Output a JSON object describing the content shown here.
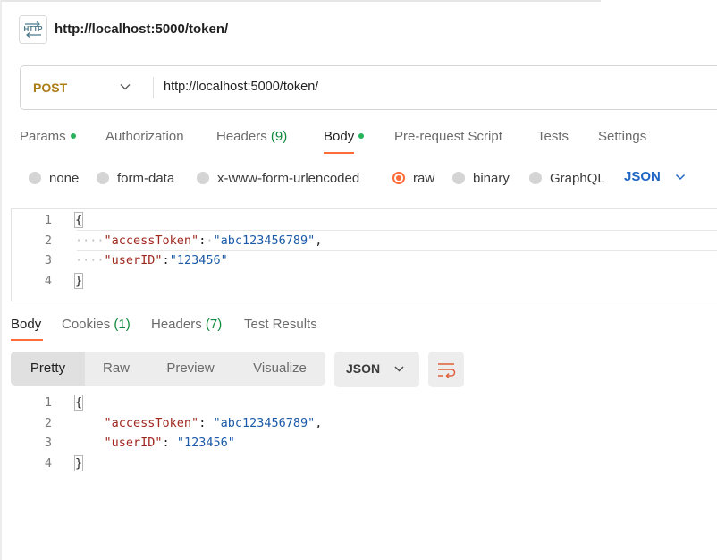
{
  "header": {
    "title": "http://localhost:5000/token/",
    "icon": "http-icon"
  },
  "request": {
    "method": "POST",
    "url": "http://localhost:5000/token/",
    "tabs": [
      {
        "label": "Params"
      },
      {
        "label": "Authorization"
      },
      {
        "label": "Headers",
        "count": "(9)"
      },
      {
        "label": "Body"
      },
      {
        "label": "Pre-request Script"
      },
      {
        "label": "Tests"
      },
      {
        "label": "Settings"
      }
    ],
    "active_tab": "Body",
    "body_types": [
      "none",
      "form-data",
      "x-www-form-urlencoded",
      "raw",
      "binary",
      "GraphQL"
    ],
    "selected_body_type": "raw",
    "format": "JSON",
    "editor": {
      "line_numbers": [
        "1",
        "2",
        "3",
        "4"
      ],
      "open_brace": "{",
      "close_brace": "}",
      "key1": "\"accessToken\"",
      "val1": "\"abc123456789\"",
      "key2": "\"userID\"",
      "val2": "\"123456\""
    }
  },
  "response": {
    "tabs": [
      {
        "label": "Body"
      },
      {
        "label": "Cookies",
        "count": "(1)"
      },
      {
        "label": "Headers",
        "count": "(7)"
      },
      {
        "label": "Test Results"
      }
    ],
    "active_tab": "Body",
    "views": [
      "Pretty",
      "Raw",
      "Preview",
      "Visualize"
    ],
    "active_view": "Pretty",
    "format": "JSON",
    "editor": {
      "line_numbers": [
        "1",
        "2",
        "3",
        "4"
      ],
      "open_brace": "{",
      "close_brace": "}",
      "key1": "\"accessToken\"",
      "val1": "\"abc123456789\"",
      "key2": "\"userID\"",
      "val2": "\"123456\""
    }
  },
  "colors": {
    "accent": "#ff6c37",
    "method_post": "#a97d14",
    "link_blue": "#1f66c4",
    "status_green": "#26b35a",
    "json_key": "#a0281f",
    "json_string": "#1a5aa8"
  }
}
